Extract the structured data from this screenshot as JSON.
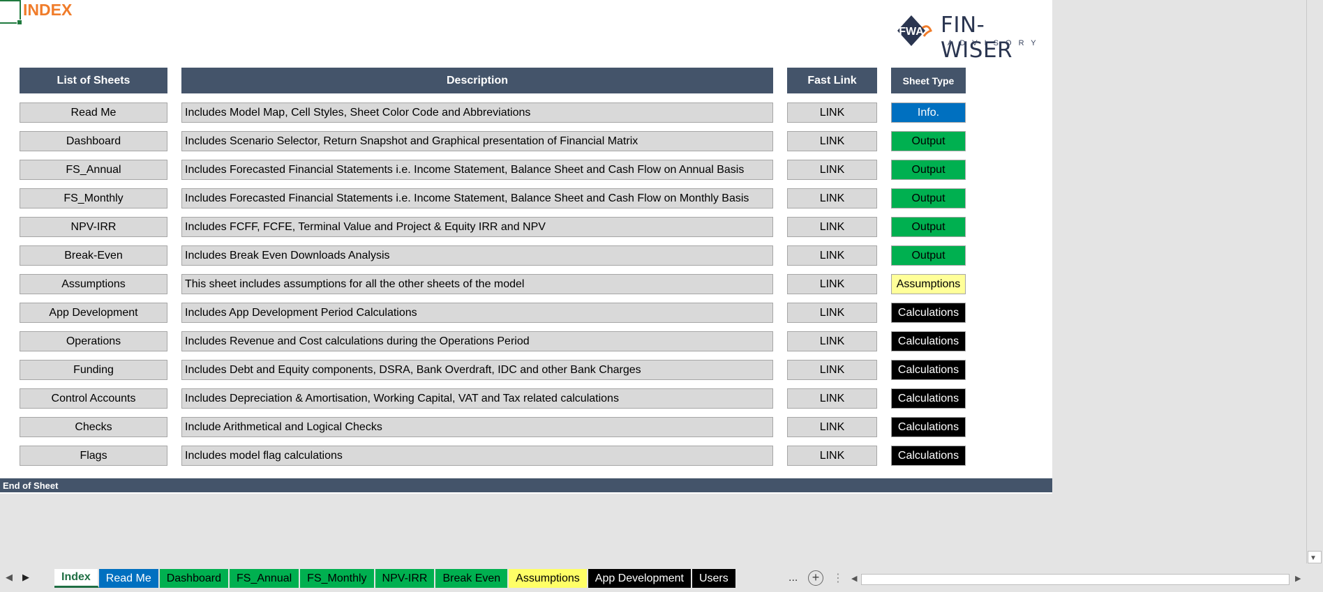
{
  "title": "INDEX",
  "logo": {
    "mark": "FWA",
    "name": "FIN-WISER",
    "sub": "ADVISORY"
  },
  "headers": {
    "sheets": "List of Sheets",
    "description": "Description",
    "link": "Fast Link",
    "type": "Sheet Type"
  },
  "colors": {
    "header": "#44546a",
    "info": "#0070c0",
    "output": "#00b050",
    "assumptions": "#ffff99",
    "calculations": "#000000",
    "accent": "#f07c2a"
  },
  "rows": [
    {
      "sheet": "Read Me",
      "description": "Includes Model Map, Cell Styles, Sheet Color Code and Abbreviations",
      "link": "LINK",
      "type": "Info."
    },
    {
      "sheet": "Dashboard",
      "description": "Includes Scenario Selector, Return Snapshot and Graphical presentation of Financial Matrix",
      "link": "LINK",
      "type": "Output"
    },
    {
      "sheet": "FS_Annual",
      "description": "Includes Forecasted Financial Statements i.e. Income Statement, Balance Sheet and Cash Flow on Annual Basis",
      "link": "LINK",
      "type": "Output"
    },
    {
      "sheet": "FS_Monthly",
      "description": "Includes Forecasted Financial Statements i.e. Income Statement, Balance Sheet and Cash Flow on Monthly Basis",
      "link": "LINK",
      "type": "Output"
    },
    {
      "sheet": "NPV-IRR",
      "description": "Includes FCFF, FCFE, Terminal Value and Project & Equity IRR and NPV",
      "link": "LINK",
      "type": "Output"
    },
    {
      "sheet": "Break-Even",
      "description": "Includes Break Even Downloads Analysis",
      "link": "LINK",
      "type": "Output"
    },
    {
      "sheet": "Assumptions",
      "description": "This sheet includes assumptions for all the other sheets of the model",
      "link": "LINK",
      "type": "Assumptions"
    },
    {
      "sheet": "App Development",
      "description": "Includes App Development Period Calculations",
      "link": "LINK",
      "type": "Calculations"
    },
    {
      "sheet": "Operations",
      "description": "Includes Revenue and Cost calculations during the Operations Period",
      "link": "LINK",
      "type": "Calculations"
    },
    {
      "sheet": "Funding",
      "description": "Includes Debt and Equity components, DSRA, Bank Overdraft, IDC and other Bank Charges",
      "link": "LINK",
      "type": "Calculations"
    },
    {
      "sheet": "Control Accounts",
      "description": "Includes Depreciation & Amortisation, Working Capital, VAT and Tax related calculations",
      "link": "LINK",
      "type": "Calculations"
    },
    {
      "sheet": "Checks",
      "description": "Include Arithmetical and Logical Checks",
      "link": "LINK",
      "type": "Calculations"
    },
    {
      "sheet": "Flags",
      "description": "Includes model flag calculations",
      "link": "LINK",
      "type": "Calculations"
    }
  ],
  "end_label": "End of Sheet",
  "tabs": [
    {
      "label": "Index",
      "bg": "#ffffff",
      "fg": "#1f6e43",
      "active": true
    },
    {
      "label": "Read Me",
      "bg": "#0070c0",
      "fg": "#ffffff"
    },
    {
      "label": "Dashboard",
      "bg": "#00b050",
      "fg": "#000000"
    },
    {
      "label": "FS_Annual",
      "bg": "#00b050",
      "fg": "#000000"
    },
    {
      "label": "FS_Monthly",
      "bg": "#00b050",
      "fg": "#000000"
    },
    {
      "label": "NPV-IRR",
      "bg": "#00b050",
      "fg": "#000000"
    },
    {
      "label": "Break Even",
      "bg": "#00b050",
      "fg": "#000000"
    },
    {
      "label": "Assumptions",
      "bg": "#ffff66",
      "fg": "#000000"
    },
    {
      "label": "App Development",
      "bg": "#000000",
      "fg": "#ffffff"
    },
    {
      "label": "Users",
      "bg": "#000000",
      "fg": "#ffffff"
    }
  ],
  "more_label": "..."
}
